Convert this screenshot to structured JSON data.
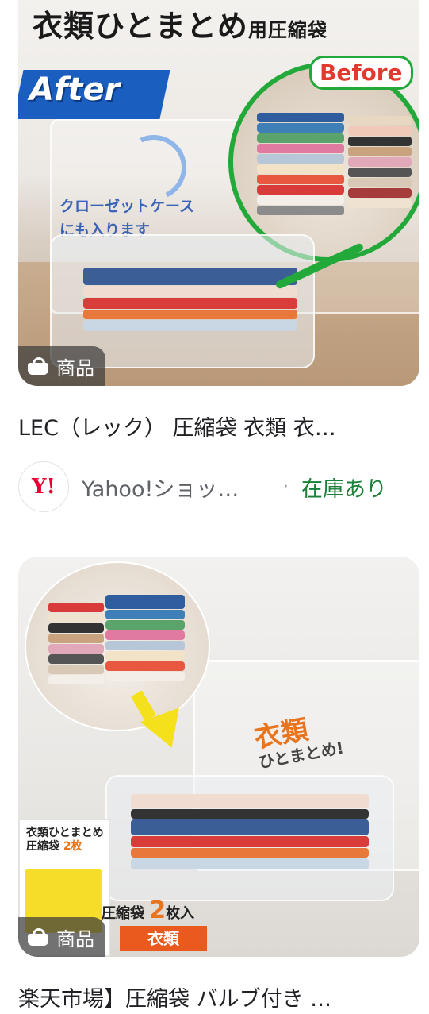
{
  "results": [
    {
      "image": {
        "title_main": "衣類ひとまとめ",
        "title_sub": "用圧縮袋",
        "after": "After",
        "before": "Before",
        "note_line1": "クローゼットケース",
        "note_line2": "にも入ります"
      },
      "chip": {
        "icon": "shopping-bag-icon",
        "label": "商品"
      },
      "title": "LEC（レック） 圧縮袋 衣類 衣…",
      "source": {
        "logo_text": "Y!",
        "store": "Yahoo!ショッ…",
        "separator": "·",
        "stock": "在庫あり"
      }
    },
    {
      "image": {
        "callout_main": "衣類",
        "callout_sub": "ひとまとめ!",
        "pkg_title": "衣類ひとまとめ",
        "pkg_sub": "圧縮袋",
        "pkg_count": "2枚",
        "badge_prefix": "圧縮袋",
        "badge_count": "2",
        "badge_suffix": "枚入",
        "bar_label": "衣類"
      },
      "chip": {
        "icon": "shopping-bag-icon",
        "label": "商品"
      },
      "title": "楽天市場】圧縮袋 バルブ付き …"
    }
  ],
  "colors": {
    "stock_green": "#188038",
    "yahoo_red": "#e60033",
    "chip_bg": "rgba(60,60,60,0.72)"
  }
}
